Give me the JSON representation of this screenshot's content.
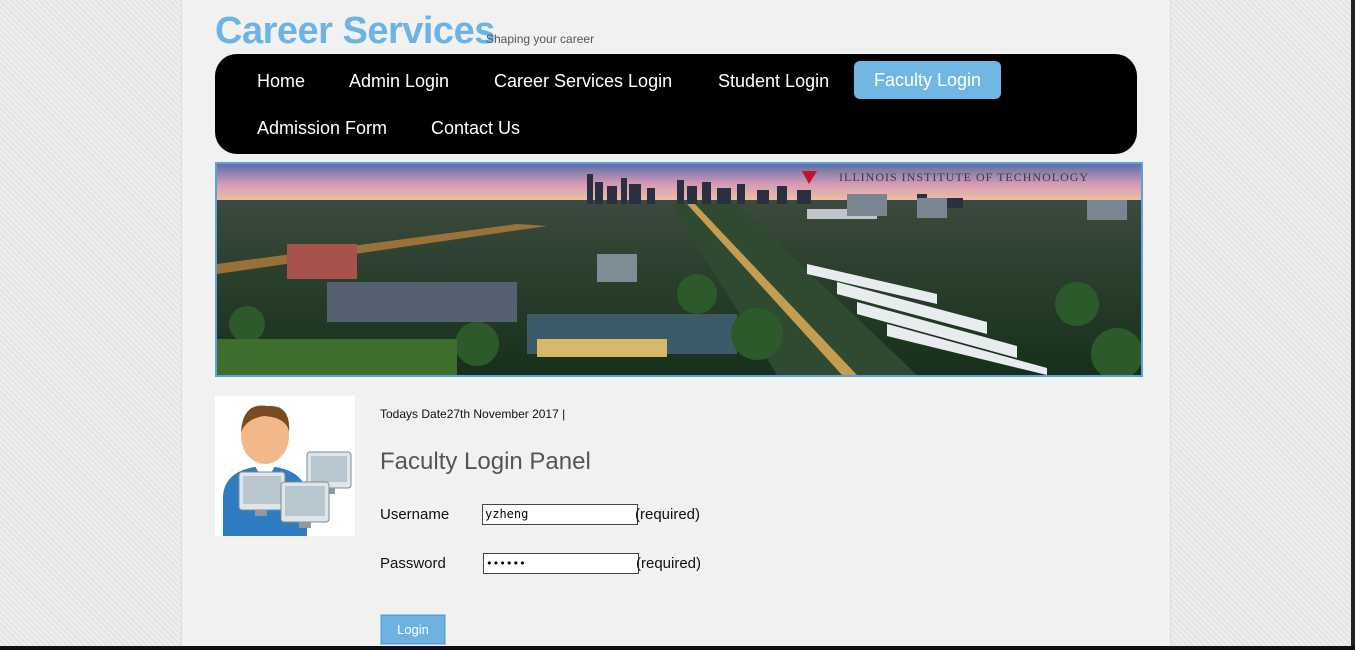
{
  "header": {
    "title": "Career Services",
    "slogan": "Shaping your career"
  },
  "nav": {
    "items": [
      {
        "label": "Home"
      },
      {
        "label": "Admin Login"
      },
      {
        "label": "Career Services Login"
      },
      {
        "label": "Student Login"
      },
      {
        "label": "Faculty Login",
        "active": true
      },
      {
        "label": "Admission Form"
      },
      {
        "label": "Contact Us"
      }
    ]
  },
  "banner": {
    "institution": "ILLINOIS INSTITUTE OF TECHNOLOGY"
  },
  "main": {
    "date_line": "Todays Date27th November 2017  |",
    "panel_title": "Faculty Login Panel",
    "username_label": "Username",
    "username_value": "yzheng",
    "password_label": "Password",
    "password_value": "••••••",
    "required_text": "(required)",
    "login_button": "Login"
  },
  "colors": {
    "brand": "#6cb4e4",
    "nav_bg": "#000000",
    "nav_active": "#70b7e4",
    "button": "#6fb2e2"
  }
}
